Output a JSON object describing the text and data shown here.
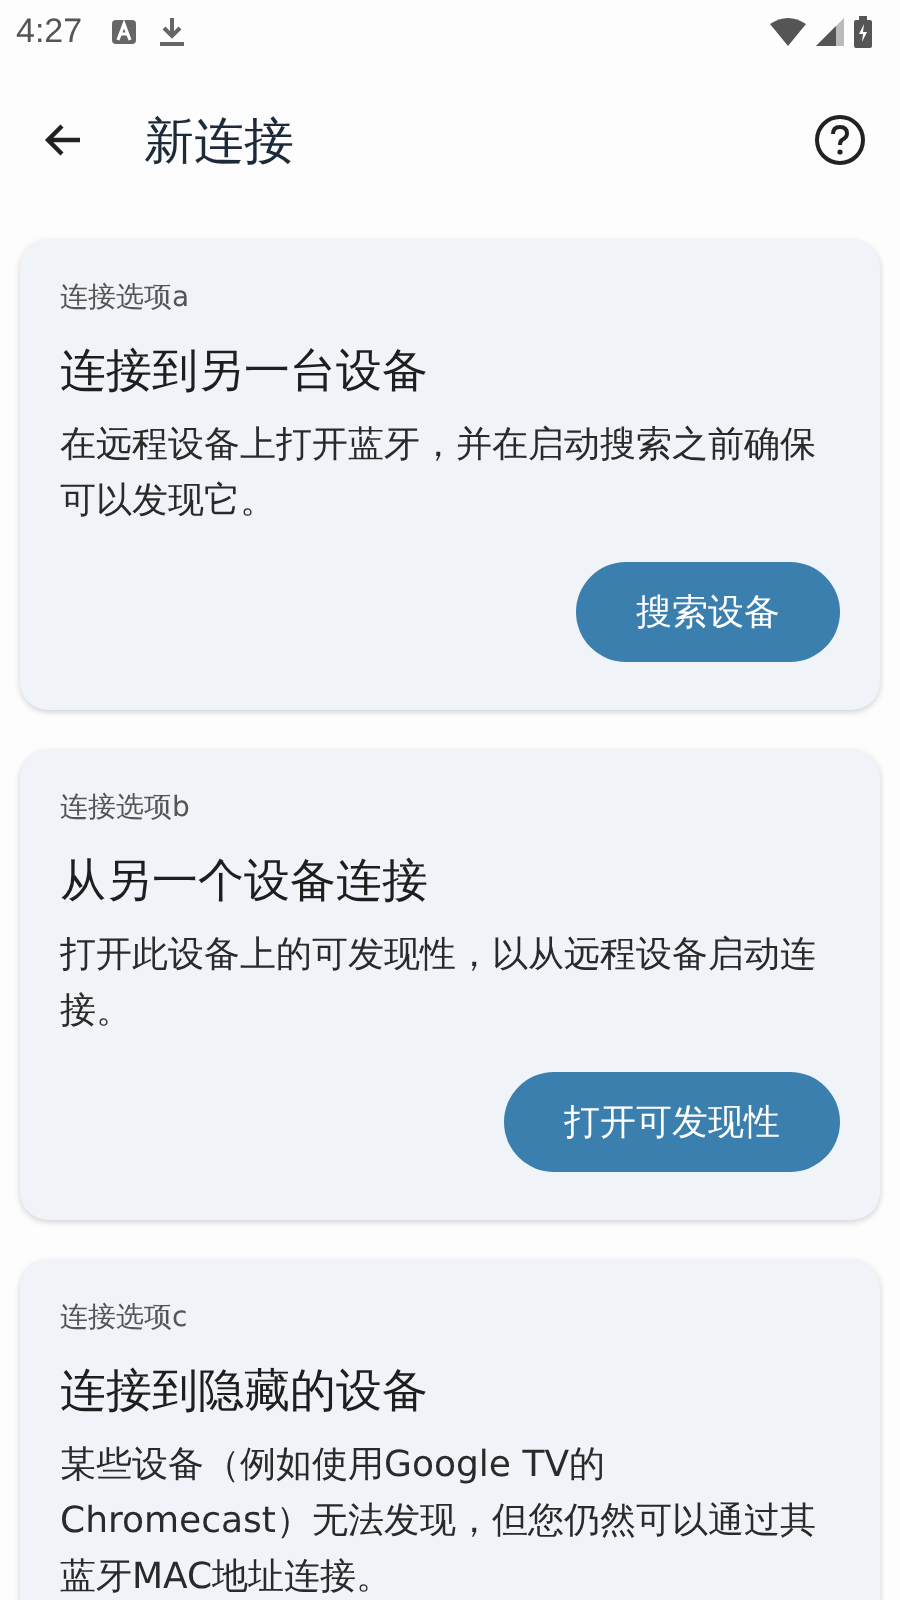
{
  "status_bar": {
    "time": "4:27"
  },
  "app_bar": {
    "title": "新连接"
  },
  "cards": [
    {
      "label": "连接选项a",
      "title": "连接到另一台设备",
      "description": "在远程设备上打开蓝牙，并在启动搜索之前确保可以发现它。",
      "button": "搜索设备"
    },
    {
      "label": "连接选项b",
      "title": "从另一个设备连接",
      "description": "打开此设备上的可发现性，以从远程设备启动连接。",
      "button": "打开可发现性"
    },
    {
      "label": "连接选项c",
      "title": "连接到隐藏的设备",
      "description": "某些设备（例如使用Google TV的Chromecast）无法发现，但您仍然可以通过其蓝牙MAC地址连接。"
    }
  ]
}
